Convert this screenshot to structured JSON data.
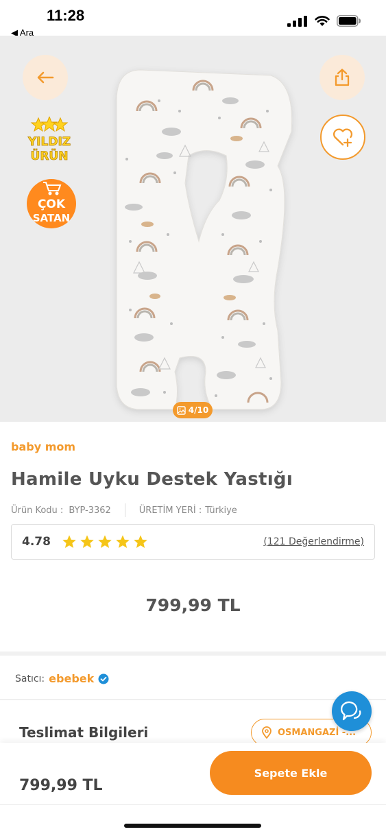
{
  "status_bar": {
    "time": "11:28",
    "back_label": "◀ Ara"
  },
  "gallery": {
    "counter": "4/10",
    "badge_yildiz": [
      "YILDIZ",
      "ÜRÜN"
    ],
    "badge_cok": [
      "ÇOK",
      "SATAN"
    ]
  },
  "product": {
    "brand": "baby mom",
    "title": "Hamile Uyku Destek Yastığı",
    "code_label": "Ürün Kodu :",
    "code_value": "BYP-3362",
    "origin_label": "ÜRETİM YERİ :",
    "origin_value": "Türkiye",
    "rating": "4.78",
    "stars": 5,
    "reviews_link": "(121 Değerlendirme)",
    "price": "799,99 TL"
  },
  "seller": {
    "label": "Satıcı:",
    "name": "ebebek"
  },
  "delivery": {
    "title": "Teslimat Bilgileri",
    "location": "OSMANGAZİ -..."
  },
  "bottom_bar": {
    "price": "799,99 TL",
    "add_to_cart": "Sepete Ekle"
  },
  "colors": {
    "accent": "#f39a2d",
    "cart_button": "#f68b1f",
    "chat": "#1f8fd8",
    "star": "#f5c518"
  },
  "icons": [
    "back-arrow-icon",
    "share-icon",
    "heart-plus-icon",
    "image-icon",
    "star-icon",
    "verified-icon",
    "location-pin-icon",
    "chat-icon"
  ]
}
